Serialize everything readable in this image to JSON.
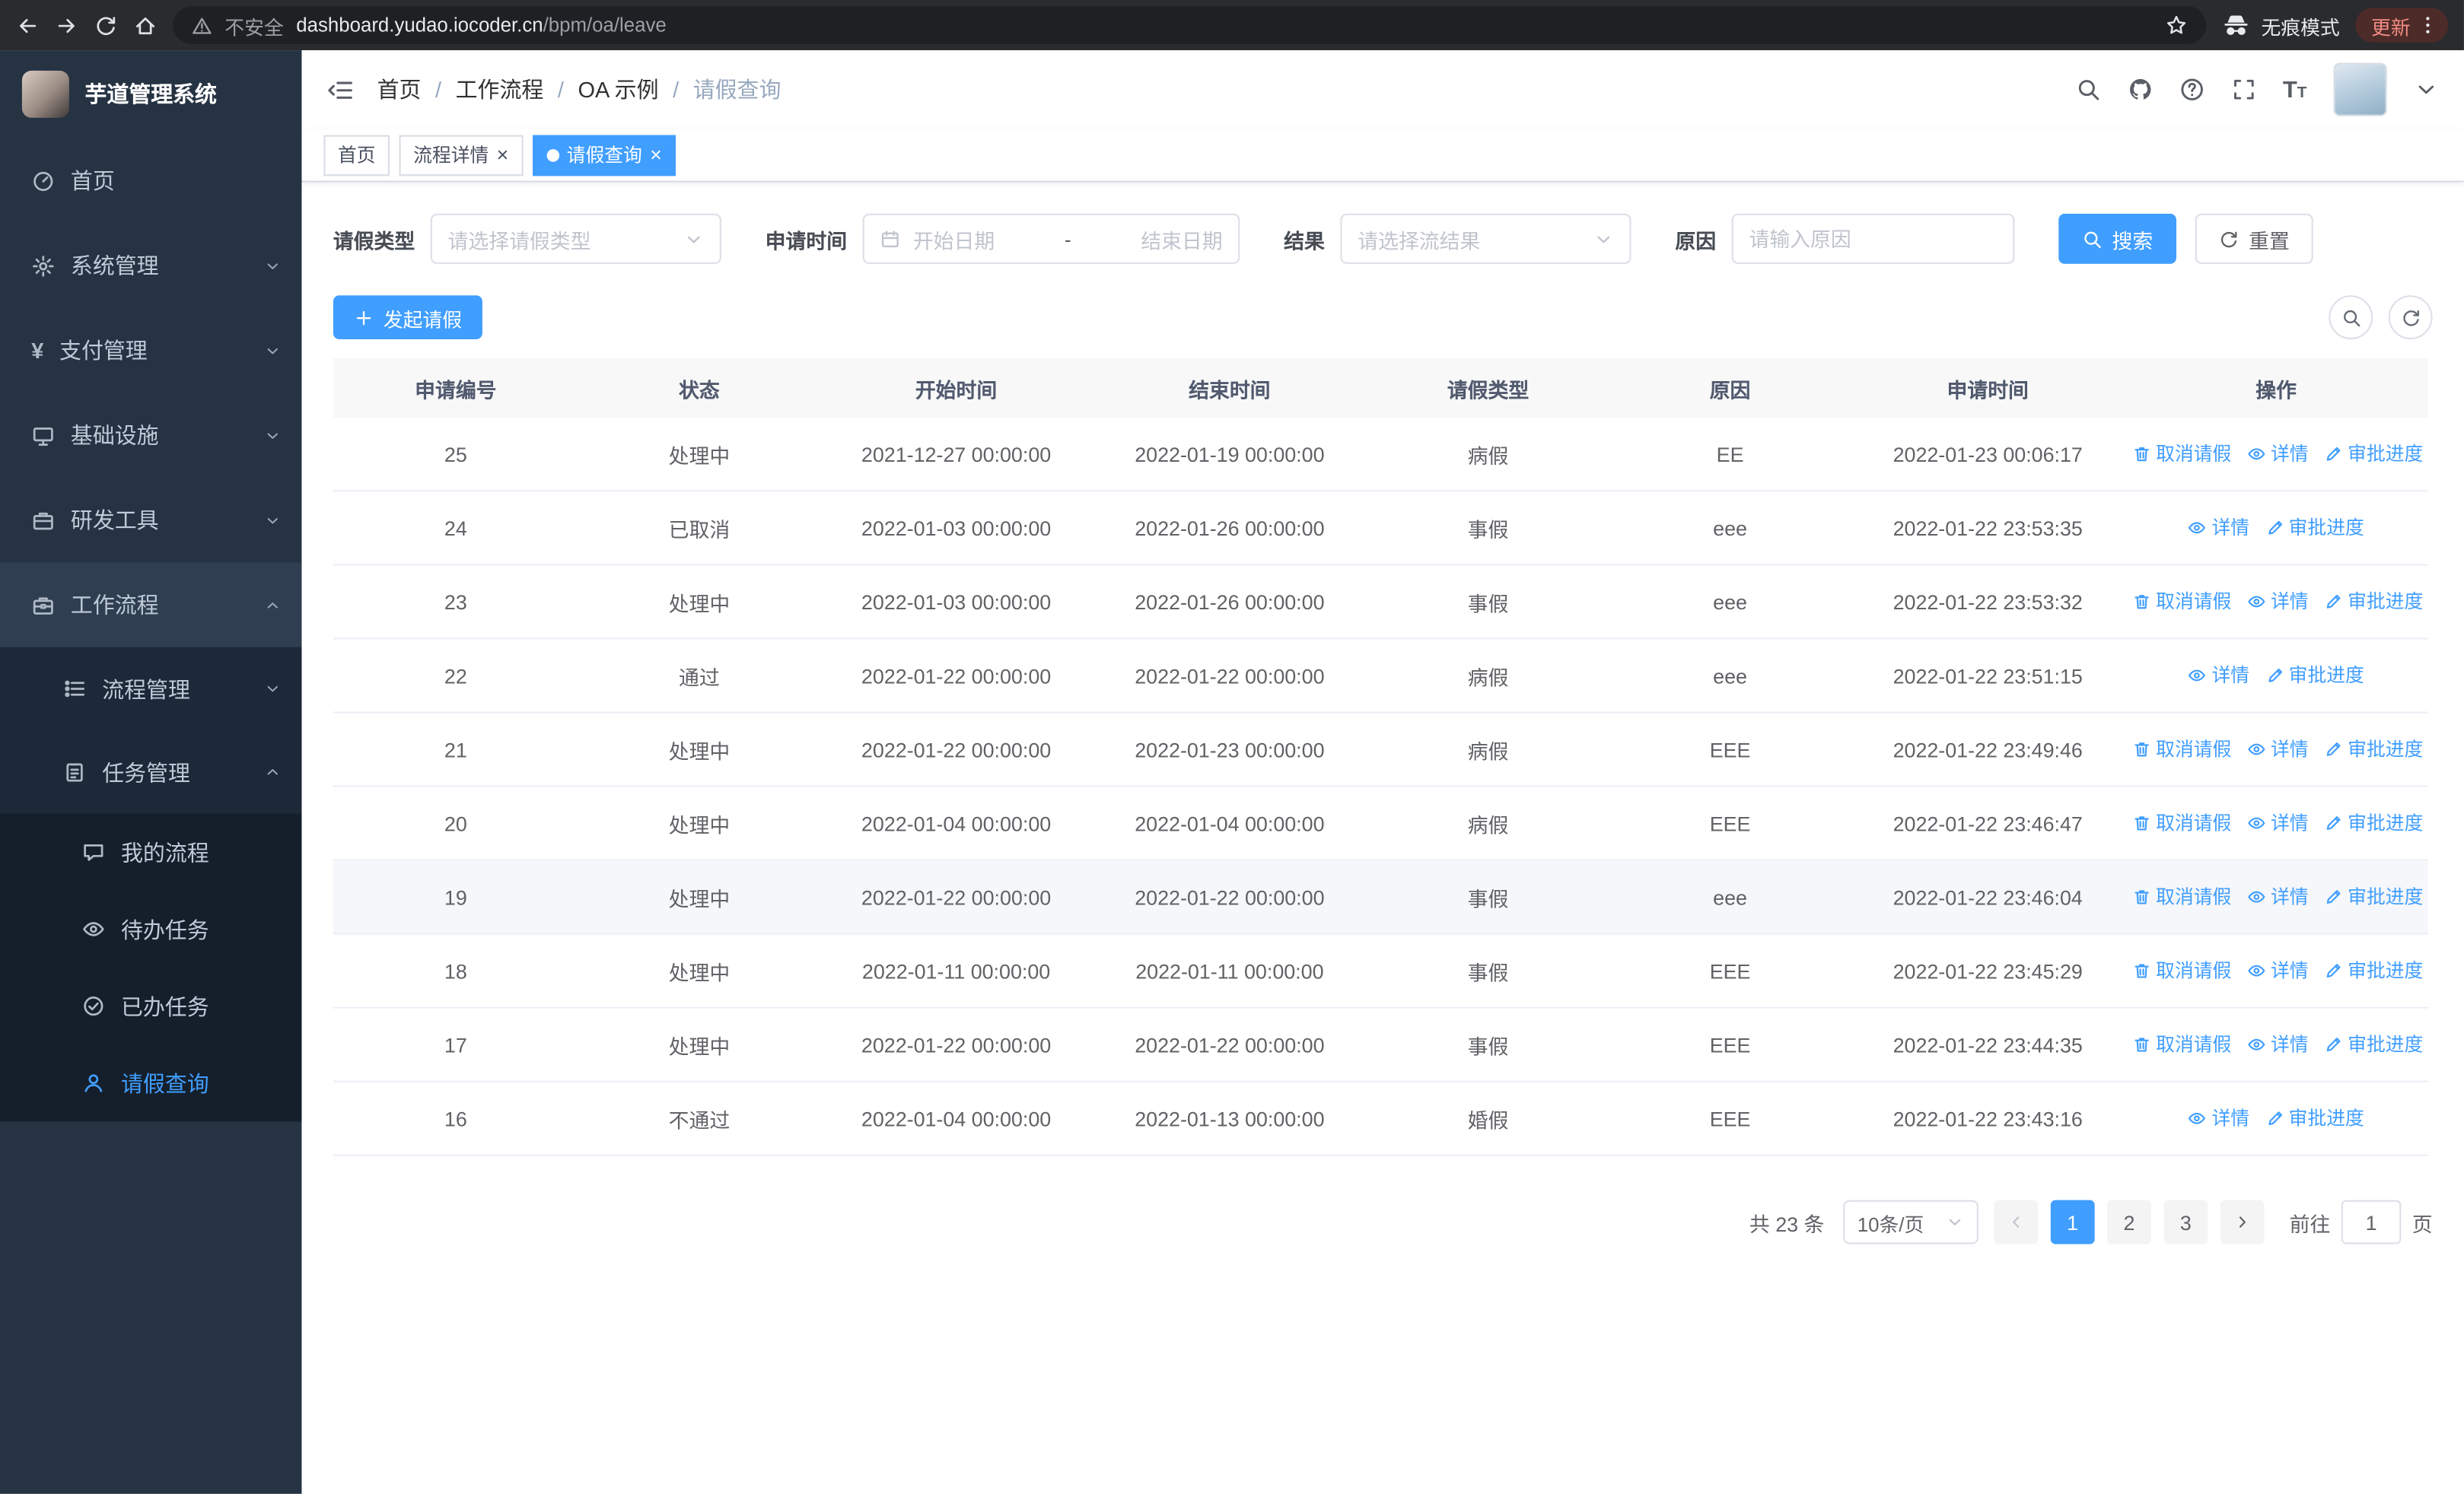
{
  "colors": {
    "primary": "#409eff",
    "sidebar_bg": "#263343"
  },
  "browser": {
    "security_label": "不安全",
    "url_host": "dashboard.yudao.iocoder.cn",
    "url_path": "/bpm/oa/leave",
    "incognito_label": "无痕模式",
    "update_label": "更新"
  },
  "sidebar": {
    "logo_title": "芋道管理系统",
    "menu": [
      {
        "label": "首页",
        "icon": "dashboard-icon",
        "type": "item",
        "level": 1
      },
      {
        "label": "系统管理",
        "icon": "gear-icon",
        "type": "submenu",
        "state": "collapsed",
        "level": 1
      },
      {
        "label": "支付管理",
        "icon": "yen-icon",
        "type": "submenu",
        "state": "collapsed",
        "level": 1
      },
      {
        "label": "基础设施",
        "icon": "monitor-icon",
        "type": "submenu",
        "state": "collapsed",
        "level": 1
      },
      {
        "label": "研发工具",
        "icon": "briefcase-icon",
        "type": "submenu",
        "state": "collapsed",
        "level": 1
      },
      {
        "label": "工作流程",
        "icon": "workflow-icon",
        "type": "submenu",
        "state": "expanded",
        "level": 1,
        "children": [
          {
            "label": "流程管理",
            "icon": "process-icon",
            "type": "submenu",
            "state": "collapsed",
            "level": 2
          },
          {
            "label": "任务管理",
            "icon": "task-icon",
            "type": "submenu",
            "state": "expanded",
            "level": 2,
            "children": [
              {
                "label": "我的流程",
                "icon": "chat-icon",
                "type": "item",
                "level": 3
              },
              {
                "label": "待办任务",
                "icon": "eye-icon",
                "type": "item",
                "level": 3
              },
              {
                "label": "已办任务",
                "icon": "completed-icon",
                "type": "item",
                "level": 3
              },
              {
                "label": "请假查询",
                "icon": "user-icon",
                "type": "item",
                "level": 3,
                "active": true
              }
            ]
          }
        ]
      }
    ]
  },
  "header": {
    "breadcrumb": [
      {
        "label": "首页"
      },
      {
        "label": "工作流程"
      },
      {
        "label": "OA 示例"
      },
      {
        "label": "请假查询",
        "current": true
      }
    ]
  },
  "tabs": [
    {
      "label": "首页",
      "closable": false,
      "active": false
    },
    {
      "label": "流程详情",
      "closable": true,
      "active": false
    },
    {
      "label": "请假查询",
      "closable": true,
      "active": true
    }
  ],
  "filters": {
    "leave_type_label": "请假类型",
    "leave_type_placeholder": "请选择请假类型",
    "apply_time_label": "申请时间",
    "start_date_placeholder": "开始日期",
    "range_separator": "-",
    "end_date_placeholder": "结束日期",
    "result_label": "结果",
    "result_placeholder": "请选择流结果",
    "reason_label": "原因",
    "reason_placeholder": "请输入原因",
    "search_label": "搜索",
    "reset_label": "重置"
  },
  "toolbar": {
    "create_label": "发起请假"
  },
  "table": {
    "columns": [
      "申请编号",
      "状态",
      "开始时间",
      "结束时间",
      "请假类型",
      "原因",
      "申请时间",
      "操作"
    ],
    "action_labels": {
      "cancel": "取消请假",
      "detail": "详情",
      "progress": "审批进度"
    },
    "rows": [
      {
        "id": "25",
        "status": "处理中",
        "start": "2021-12-27 00:00:00",
        "end": "2022-01-19 00:00:00",
        "type": "病假",
        "reason": "EE",
        "applied": "2022-01-23 00:06:17",
        "actions": [
          "cancel",
          "detail",
          "progress"
        ]
      },
      {
        "id": "24",
        "status": "已取消",
        "start": "2022-01-03 00:00:00",
        "end": "2022-01-26 00:00:00",
        "type": "事假",
        "reason": "eee",
        "applied": "2022-01-22 23:53:35",
        "actions": [
          "detail",
          "progress"
        ]
      },
      {
        "id": "23",
        "status": "处理中",
        "start": "2022-01-03 00:00:00",
        "end": "2022-01-26 00:00:00",
        "type": "事假",
        "reason": "eee",
        "applied": "2022-01-22 23:53:32",
        "actions": [
          "cancel",
          "detail",
          "progress"
        ]
      },
      {
        "id": "22",
        "status": "通过",
        "start": "2022-01-22 00:00:00",
        "end": "2022-01-22 00:00:00",
        "type": "病假",
        "reason": "eee",
        "applied": "2022-01-22 23:51:15",
        "actions": [
          "detail",
          "progress"
        ]
      },
      {
        "id": "21",
        "status": "处理中",
        "start": "2022-01-22 00:00:00",
        "end": "2022-01-23 00:00:00",
        "type": "病假",
        "reason": "EEE",
        "applied": "2022-01-22 23:49:46",
        "actions": [
          "cancel",
          "detail",
          "progress"
        ]
      },
      {
        "id": "20",
        "status": "处理中",
        "start": "2022-01-04 00:00:00",
        "end": "2022-01-04 00:00:00",
        "type": "病假",
        "reason": "EEE",
        "applied": "2022-01-22 23:46:47",
        "actions": [
          "cancel",
          "detail",
          "progress"
        ]
      },
      {
        "id": "19",
        "status": "处理中",
        "start": "2022-01-22 00:00:00",
        "end": "2022-01-22 00:00:00",
        "type": "事假",
        "reason": "eee",
        "applied": "2022-01-22 23:46:04",
        "actions": [
          "cancel",
          "detail",
          "progress"
        ],
        "highlighted": true
      },
      {
        "id": "18",
        "status": "处理中",
        "start": "2022-01-11 00:00:00",
        "end": "2022-01-11 00:00:00",
        "type": "事假",
        "reason": "EEE",
        "applied": "2022-01-22 23:45:29",
        "actions": [
          "cancel",
          "detail",
          "progress"
        ]
      },
      {
        "id": "17",
        "status": "处理中",
        "start": "2022-01-22 00:00:00",
        "end": "2022-01-22 00:00:00",
        "type": "事假",
        "reason": "EEE",
        "applied": "2022-01-22 23:44:35",
        "actions": [
          "cancel",
          "detail",
          "progress"
        ]
      },
      {
        "id": "16",
        "status": "不通过",
        "start": "2022-01-04 00:00:00",
        "end": "2022-01-13 00:00:00",
        "type": "婚假",
        "reason": "EEE",
        "applied": "2022-01-22 23:43:16",
        "actions": [
          "detail",
          "progress"
        ]
      }
    ]
  },
  "pagination": {
    "total_text": "共 23 条",
    "page_size": "10条/页",
    "pages": [
      "1",
      "2",
      "3"
    ],
    "active_page": "1",
    "goto_label": "前往",
    "goto_value": "1",
    "page_label": "页"
  }
}
